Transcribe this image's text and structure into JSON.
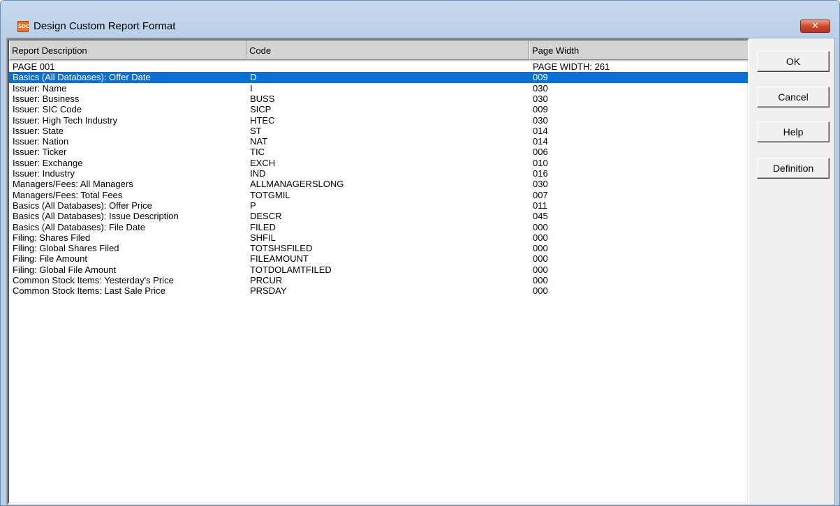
{
  "window": {
    "title": "Design Custom Report Format",
    "icon": "app-icon",
    "close_glyph": "✕"
  },
  "table": {
    "columns": [
      "Report Description",
      "Code",
      "Page Width"
    ],
    "rows": [
      {
        "desc": "PAGE 001",
        "code": "",
        "width": "PAGE WIDTH: 261"
      },
      {
        "desc": "Basics (All Databases): Offer Date",
        "code": "D",
        "width": "009",
        "selected": true
      },
      {
        "desc": "Issuer: Name",
        "code": "I",
        "width": "030"
      },
      {
        "desc": "Issuer: Business",
        "code": "BUSS",
        "width": "030"
      },
      {
        "desc": "Issuer: SIC Code",
        "code": "SICP",
        "width": "009"
      },
      {
        "desc": "Issuer: High Tech Industry",
        "code": "HTEC",
        "width": "030"
      },
      {
        "desc": "Issuer: State",
        "code": "ST",
        "width": "014"
      },
      {
        "desc": "Issuer: Nation",
        "code": "NAT",
        "width": "014"
      },
      {
        "desc": "Issuer: Ticker",
        "code": "TIC",
        "width": "006"
      },
      {
        "desc": "Issuer: Exchange",
        "code": "EXCH",
        "width": "010"
      },
      {
        "desc": "Issuer: Industry",
        "code": "IND",
        "width": "016"
      },
      {
        "desc": "Managers/Fees: All Managers",
        "code": "ALLMANAGERSLONG",
        "width": "030"
      },
      {
        "desc": "Managers/Fees: Total Fees",
        "code": "TOTGMIL",
        "width": "007"
      },
      {
        "desc": "Basics (All Databases): Offer Price",
        "code": "P",
        "width": "011"
      },
      {
        "desc": "Basics (All Databases): Issue Description",
        "code": "DESCR",
        "width": "045"
      },
      {
        "desc": "Basics (All Databases): File Date",
        "code": "FILED",
        "width": "000"
      },
      {
        "desc": "Filing: Shares Filed",
        "code": "SHFIL",
        "width": "000"
      },
      {
        "desc": "Filing: Global Shares Filed",
        "code": "TOTSHSFILED",
        "width": "000"
      },
      {
        "desc": "Filing: File Amount",
        "code": "FILEAMOUNT",
        "width": "000"
      },
      {
        "desc": "Filing: Global File Amount",
        "code": "TOTDOLAMTFILED",
        "width": "000"
      },
      {
        "desc": "Common Stock Items: Yesterday's Price",
        "code": "PRCUR",
        "width": "000"
      },
      {
        "desc": "Common Stock Items: Last Sale Price",
        "code": "PRSDAY",
        "width": "000"
      }
    ]
  },
  "buttons": {
    "ok": "OK",
    "cancel": "Cancel",
    "help": "Help",
    "definition": "Definition"
  },
  "colors": {
    "selection": "#0b6fd3",
    "title_bar": "#c1d5ec"
  }
}
